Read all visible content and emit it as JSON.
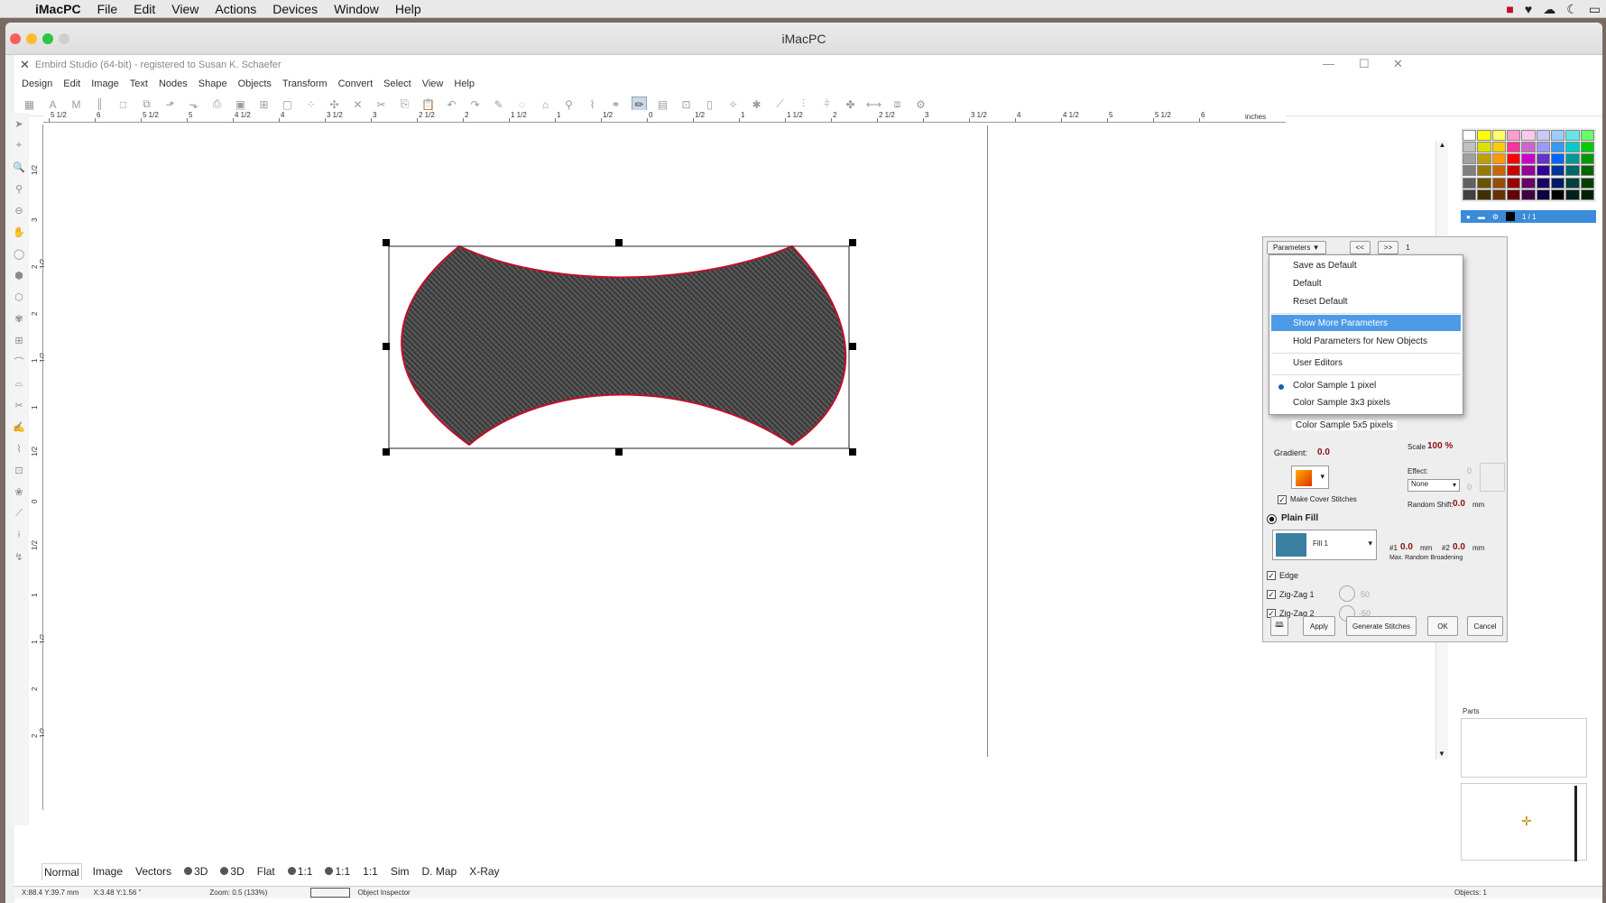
{
  "mac_menubar": {
    "app_name": "iMacPC",
    "items": [
      "File",
      "Edit",
      "View",
      "Actions",
      "Devices",
      "Window",
      "Help"
    ]
  },
  "mac_window": {
    "title": "iMacPC"
  },
  "app": {
    "title": "Embird Studio (64-bit) - registered to Susan K. Schaefer",
    "menu": [
      "Design",
      "Edit",
      "Image",
      "Text",
      "Nodes",
      "Shape",
      "Objects",
      "Transform",
      "Convert",
      "Select",
      "View",
      "Help"
    ]
  },
  "ruler": {
    "labels": [
      "5 1/2",
      "6",
      "5 1/2",
      "5",
      "4 1/2",
      "4",
      "3 1/2",
      "3",
      "2 1/2",
      "2",
      "1 1/2",
      "1",
      "1/2",
      "0",
      "1/2",
      "1",
      "1 1/2",
      "2",
      "2 1/2",
      "3",
      "3 1/2",
      "4",
      "4 1/2",
      "5",
      "5 1/2",
      "6"
    ],
    "unit": "inches",
    "left_labels": [
      "1/2",
      "3",
      "2 1/2",
      "2",
      "1 1/2",
      "1",
      "1/2",
      "0",
      "1/2",
      "1",
      "1 1/2",
      "2",
      "2 1/2"
    ]
  },
  "param_panel": {
    "button": "Parameters",
    "prev": "<<",
    "next": ">>",
    "index": "1",
    "menu": {
      "save_default": "Save as Default",
      "default": "Default",
      "reset_default": "Reset Default",
      "show_more": "Show More Parameters",
      "hold_params": "Hold Parameters for New Objects",
      "user_editors": "User Editors",
      "color_1": "Color Sample 1 pixel",
      "color_3": "Color Sample 3x3 pixels",
      "color_5": "Color Sample 5x5 pixels"
    },
    "gradient_label": "Gradient:",
    "gradient_value": "0.0",
    "scale_label": "Scale",
    "scale_value": "100 %",
    "effect_label": "Effect:",
    "effect_value": "None",
    "effect_num1": "0",
    "effect_num2": "0",
    "make_cover": "Make Cover Stitches",
    "random_shift_label": "Random Shift:",
    "random_shift_value": "0.0",
    "random_shift_unit": "mm",
    "plain_fill": "Plain Fill",
    "fill_name": "Fill 1",
    "broad1_label": "#1",
    "broad1_value": "0.0",
    "broad2_label": "#2",
    "broad2_value": "0.0",
    "broad_unit": "mm",
    "max_random": "Max. Random Broadening",
    "edge": "Edge",
    "zigzag1": "Zig-Zag 1",
    "zigzag1_val": "50",
    "zigzag2": "Zig-Zag 2",
    "zigzag2_val": "-50",
    "apply": "Apply",
    "generate": "Generate Stitches",
    "ok": "OK",
    "cancel": "Cancel"
  },
  "layer": {
    "label": "1 / 1"
  },
  "bottom_tabs": [
    "Normal",
    "Image",
    "Vectors",
    "3D",
    "3D",
    "Flat",
    "1:1",
    "1:1",
    "1:1",
    "Sim",
    "D. Map",
    "X-Ray"
  ],
  "status": {
    "pos1": "X:88.4  Y:39.7 mm",
    "pos2": "X:3.48  Y:1.56 \"",
    "zoom": "Zoom: 0.5 (133%)",
    "inspector": "Object Inspector",
    "objects": "Objects: 1"
  },
  "parts": {
    "label": "Parts"
  },
  "colors": {
    "selection": "#4d9be6",
    "outline": "#c0102a",
    "fill": "#3d3d3d"
  },
  "palette": [
    "#ffffff",
    "#ffff00",
    "#ffff66",
    "#ff9bd0",
    "#ffc8e8",
    "#c8c8ff",
    "#99ccff",
    "#66e6e6",
    "#66ff66",
    "#c0c0c0",
    "#e0e000",
    "#ffcc00",
    "#ff3399",
    "#cc66cc",
    "#9999ff",
    "#3399ff",
    "#00cccc",
    "#00cc00",
    "#a0a0a0",
    "#c0a000",
    "#ff9900",
    "#ff0000",
    "#cc00cc",
    "#6633cc",
    "#0066ff",
    "#009999",
    "#009900",
    "#808080",
    "#997a00",
    "#cc6600",
    "#cc0000",
    "#990099",
    "#330099",
    "#003399",
    "#006666",
    "#006600",
    "#606060",
    "#6b5200",
    "#994d00",
    "#990000",
    "#660066",
    "#1a0066",
    "#001a66",
    "#004040",
    "#004000",
    "#404040",
    "#403000",
    "#663300",
    "#660000",
    "#400040",
    "#100040",
    "#000000",
    "#002020",
    "#002000"
  ]
}
